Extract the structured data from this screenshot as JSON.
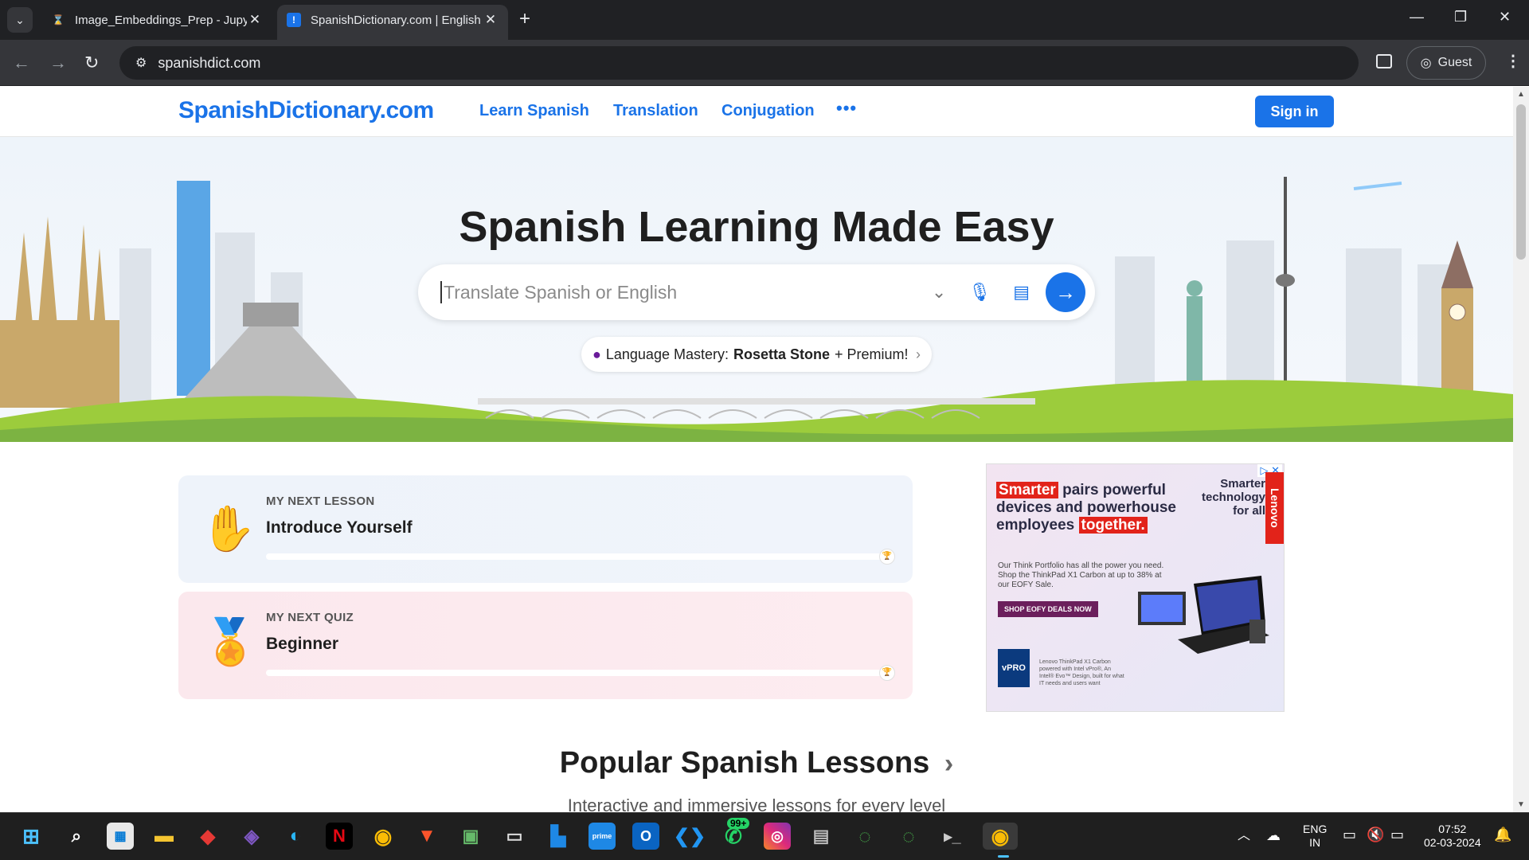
{
  "browser": {
    "tabs": [
      {
        "title": "Image_Embeddings_Prep - Jupy",
        "active": false
      },
      {
        "title": "SpanishDictionary.com | English",
        "active": true
      }
    ],
    "url": "spanishdict.com",
    "profile_label": "Guest"
  },
  "site": {
    "logo": "SpanishDictionary.com",
    "nav": [
      "Learn Spanish",
      "Translation",
      "Conjugation"
    ],
    "more_label": "•••",
    "sign_in": "Sign in"
  },
  "hero": {
    "title": "Spanish Learning Made Easy",
    "search_placeholder": "Translate Spanish or English",
    "promo_prefix": "Language Mastery:",
    "promo_brand": "Rosetta Stone",
    "promo_suffix": "+ Premium!"
  },
  "lessons": [
    {
      "label": "MY NEXT LESSON",
      "name": "Introduce Yourself",
      "progress": 0
    },
    {
      "label": "MY NEXT QUIZ",
      "name": "Beginner",
      "progress": 0
    }
  ],
  "ad": {
    "headline_highlight": "Smarter",
    "headline_rest": "pairs powerful devices and powerhouse employees",
    "headline_end": "together.",
    "tagline": "Smarter technology for all",
    "brand": "Lenovo",
    "body": "Our Think Portfolio has all the power you need. Shop the ThinkPad X1 Carbon at up to 38% at our EOFY Sale.",
    "cta": "SHOP EOFY DEALS NOW",
    "badge": "vPRO",
    "fine_print": "Lenovo ThinkPad X1 Carbon powered with Intel vPro®, An Intel® Evo™ Design, built for what IT needs and users want"
  },
  "popular": {
    "title": "Popular Spanish Lessons",
    "arrow": "›",
    "subtitle": "Interactive and immersive lessons for every level"
  },
  "taskbar": {
    "notification_badge": "99+",
    "lang_line1": "ENG",
    "lang_line2": "IN",
    "time": "07:52",
    "date": "02-03-2024"
  }
}
